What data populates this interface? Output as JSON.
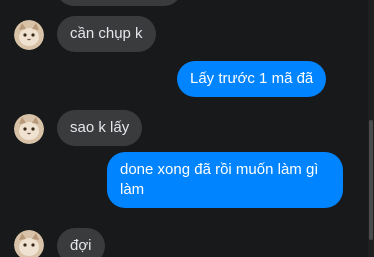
{
  "messages": [
    {
      "direction": "in",
      "text": "cần chụp k"
    },
    {
      "direction": "out",
      "text": "Lấy trước 1 mã đã"
    },
    {
      "direction": "in",
      "text": "sao k lấy"
    },
    {
      "direction": "out",
      "text": "done xong đã rồi muốn làm gì làm"
    },
    {
      "direction": "in",
      "text": "đợi"
    }
  ],
  "colors": {
    "background": "#18191a",
    "incoming_bubble": "#3a3b3c",
    "outgoing_bubble": "#0084ff",
    "incoming_text": "#e4e6eb",
    "outgoing_text": "#ffffff"
  },
  "avatar_icon": "cat-avatar-icon"
}
